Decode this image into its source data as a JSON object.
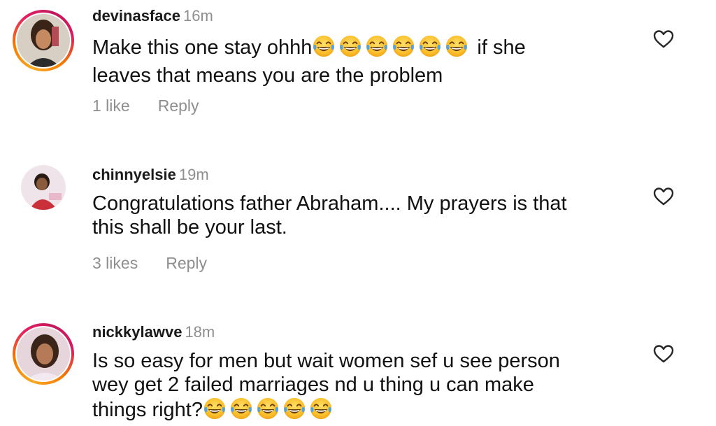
{
  "comments": [
    {
      "username": "devinasface",
      "time": "16m",
      "text_part1": "Make this one stay ohhh",
      "emoji_mid": [
        "face-with-tears-of-joy",
        "face-with-tears-of-joy",
        "face-with-tears-of-joy",
        "face-with-tears-of-joy",
        "face-with-tears-of-joy",
        "face-with-tears-of-joy"
      ],
      "text_part2": " if she",
      "text_part3": "leaves that means you are the problem",
      "likes": "1 like",
      "reply": "Reply",
      "has_story": true
    },
    {
      "username": "chinnyelsie",
      "time": "19m",
      "text_line1": "Congratulations father Abraham.... My prayers is that",
      "text_line2": "this shall be your last.",
      "likes": "3 likes",
      "reply": "Reply",
      "has_story": false
    },
    {
      "username": "nickkylawve",
      "time": "18m",
      "text_line1": "Is so easy for men but wait women sef u see person",
      "text_line2": "wey get 2 failed marriages nd u thing u can make",
      "text_line3": "things right?",
      "emoji_end": [
        "face-with-tears-of-joy",
        "face-with-tears-of-joy",
        "face-with-tears-of-joy",
        "face-with-tears-of-joy",
        "face-with-tears-of-joy"
      ],
      "has_story": true
    }
  ],
  "icons": {
    "like": "heart-outline-icon",
    "emoji": "face-with-tears-of-joy-emoji"
  },
  "colors": {
    "username": "#1a1a1a",
    "secondary_text": "#8e8e8e",
    "body_text": "#111111",
    "story_ring_start": "#f9a825",
    "story_ring_end": "#d81b60",
    "emoji_face": "#fbc02d",
    "emoji_tear": "#4fa3e0"
  }
}
